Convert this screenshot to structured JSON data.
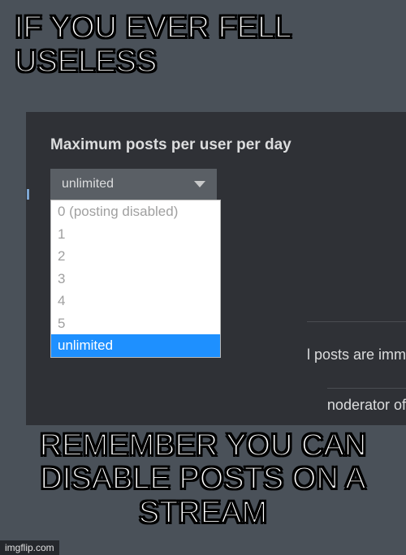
{
  "meme": {
    "top": "IF YOU EVER FELL USELESS",
    "bottom_line1": "REMEMBER YOU CAN",
    "bottom_line2": "DISABLE POSTS ON A STREAM"
  },
  "setting": {
    "label": "Maximum posts per user per day"
  },
  "dropdown": {
    "selected": "unlimited",
    "options": [
      "0 (posting disabled)",
      "1",
      "2",
      "3",
      "4",
      "5",
      "unlimited"
    ],
    "selected_index": 6
  },
  "partial": {
    "line1": "l posts are imm",
    "line2": "noderator of ",
    "edge": "I"
  },
  "watermark": "imgflip.com"
}
